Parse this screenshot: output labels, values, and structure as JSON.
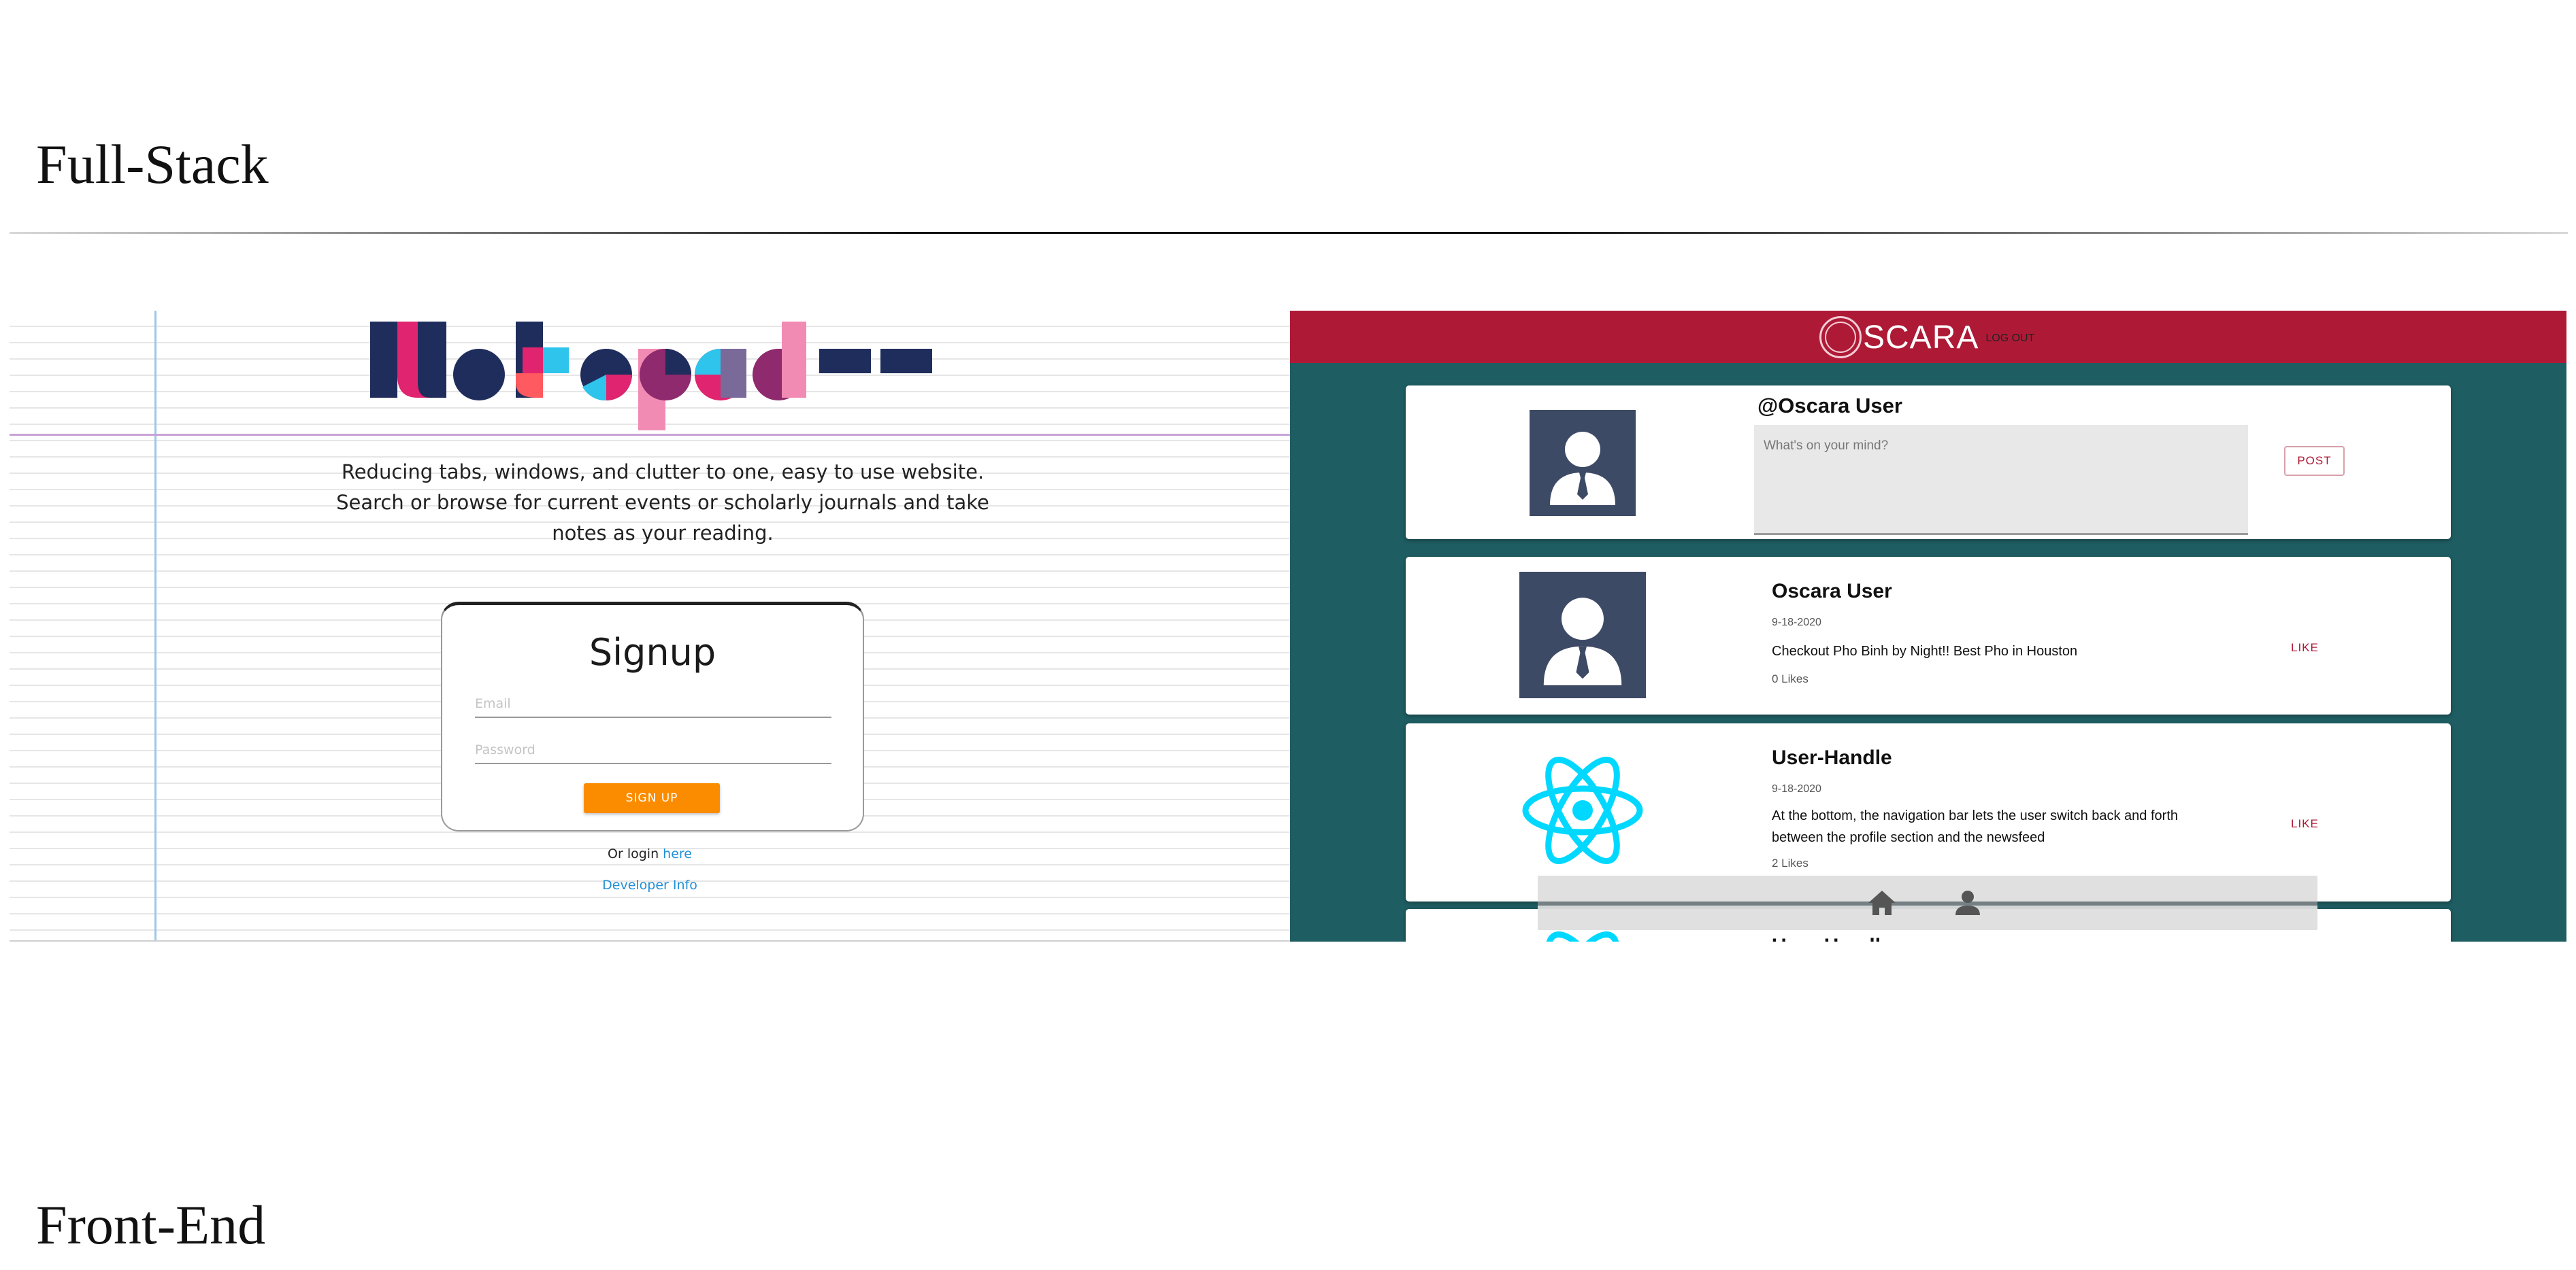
{
  "sections": {
    "fullstack_title": "Full-Stack",
    "frontend_title": "Front-End"
  },
  "notepad": {
    "logo_text": "Notepad--",
    "tagline_line1": "Reducing tabs, windows, and clutter to one, easy to use website.",
    "tagline_line2": "Search or browse for current events or scholarly journals and take",
    "tagline_line3": "notes as your reading.",
    "signup": {
      "title": "Signup",
      "email_placeholder": "Email",
      "password_placeholder": "Password",
      "button_label": "SIGN UP"
    },
    "login_prefix": "Or login ",
    "login_link": "here",
    "developer_link": "Developer Info",
    "colors": {
      "navy": "#1f2d5c",
      "pink": "#e0246f",
      "cyan": "#2ec4ec",
      "light_pink": "#f28bb4",
      "orange_button": "#fb8c00"
    }
  },
  "oscara": {
    "brand": "SCARA",
    "logout": "LOG OUT",
    "composer": {
      "handle": "@Oscara User",
      "placeholder": "What's on your mind?",
      "post_button": "POST"
    },
    "posts": [
      {
        "user": "Oscara User",
        "date": "9-18-2020",
        "text": "Checkout Pho Binh by Night!! Best Pho in Houston",
        "likes": "0 Likes",
        "like_button": "LIKE",
        "avatar": "person-icon"
      },
      {
        "user": "User-Handle",
        "date": "9-18-2020",
        "text": "At the bottom, the navigation bar lets the user switch back and forth between the profile section and the newsfeed",
        "likes": "2 Likes",
        "like_button": "LIKE",
        "avatar": "react-atom-icon"
      },
      {
        "user": "User-Handle",
        "avatar": "react-atom-icon"
      }
    ],
    "nav_icons": [
      "home-icon",
      "user-icon"
    ],
    "colors": {
      "header": "#ae1a36",
      "background": "#1e5d62",
      "avatar_bg": "#3d4a66",
      "react_cyan": "#00d8ff"
    }
  }
}
